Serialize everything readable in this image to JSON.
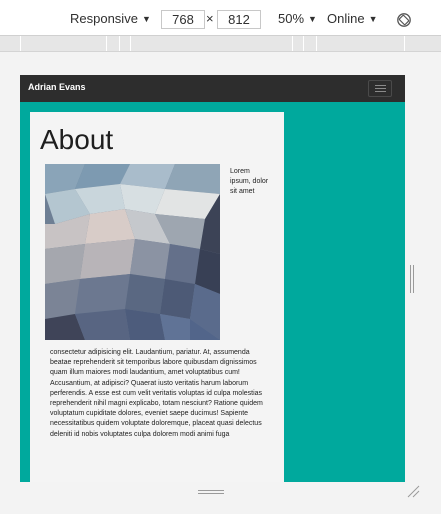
{
  "toolbar": {
    "device": "Responsive",
    "width": "768",
    "times": "×",
    "height": "812",
    "zoom": "50%",
    "network": "Online"
  },
  "site": {
    "brand": "Adrian Evans",
    "title": "About",
    "float_text": "Lorem ipsum, dolor sit amet",
    "body_text": "consectetur adipisicing elit. Laudantium, pariatur. At, assumenda beatae reprehenderit sit temporibus labore quibusdam dignissimos quam illum maiores modi laudantium, amet voluptatibus cum! Accusantium, at adipisci? Quaerat iusto veritatis harum laborum perferendis. A esse est cum velit veritatis voluptas id culpa molestias reprehenderit nihil magni explicabo, totam nesciunt? Ratione quidem voluptatum cupiditate dolores, eveniet saepe ducimus! Sapiente necessitatibus quidem voluptate doloremque, placeat quasi delectus deleniti id nobis voluptates culpa dolorem modi animi fuga"
  },
  "colors": {
    "viewport_bg": "#00a99d",
    "nav_bg": "#2d2d2d",
    "card_bg": "#f4f4f4"
  },
  "icons": {
    "rotate": "rotate-icon",
    "menu": "hamburger-icon"
  }
}
